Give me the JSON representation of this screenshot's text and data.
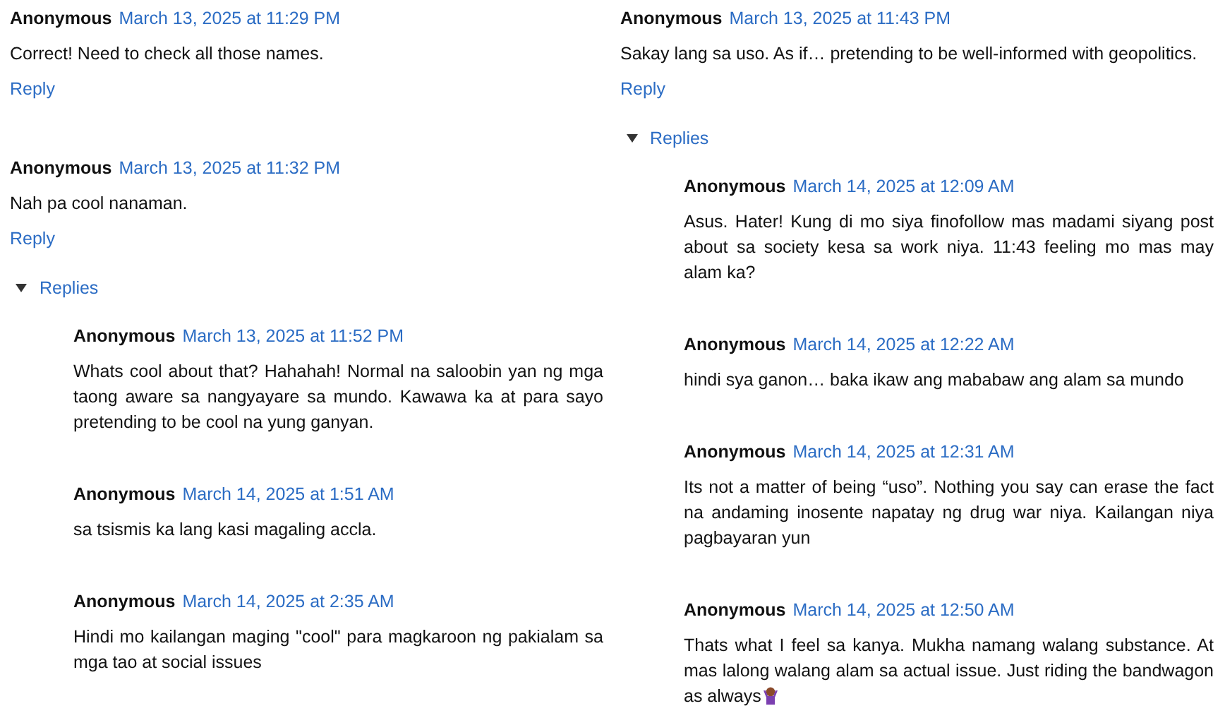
{
  "columns": [
    {
      "comments": [
        {
          "author": "Anonymous",
          "date": "March 13, 2025 at 11:29 PM",
          "body": "Correct! Need to check all those names.",
          "reply_link": "Reply"
        },
        {
          "author": "Anonymous",
          "date": "March 13, 2025 at 11:32 PM",
          "body": "Nah pa cool nanaman.",
          "reply_link": "Reply",
          "replies": {
            "label": "Replies",
            "expanded": true,
            "children": [
              {
                "author": "Anonymous",
                "date": "March 13, 2025 at 11:52 PM",
                "body": "Whats cool about that? Hahahah! Normal na saloobin yan ng mga taong aware sa nangyayare sa mundo. Kawawa ka at para sayo pretending to be cool na yung ganyan."
              },
              {
                "author": "Anonymous",
                "date": "March 14, 2025 at 1:51 AM",
                "body": "sa tsismis ka lang kasi magaling accla."
              },
              {
                "author": "Anonymous",
                "date": "March 14, 2025 at 2:35 AM",
                "body": "Hindi mo kailangan maging \"cool\" para magkaroon ng pakialam sa mga tao at social issues"
              }
            ]
          }
        }
      ]
    },
    {
      "comments": [
        {
          "author": "Anonymous",
          "date": "March 13, 2025 at 11:43 PM",
          "body": "Sakay lang sa uso. As if… pretending to be well-informed with geopolitics.",
          "reply_link": "Reply",
          "replies": {
            "label": "Replies",
            "expanded": true,
            "children": [
              {
                "author": "Anonymous",
                "date": "March 14, 2025 at 12:09 AM",
                "body": "Asus. Hater! Kung di mo siya finofollow mas madami siyang post about sa society kesa sa work niya. 11:43 feeling mo mas may alam ka?"
              },
              {
                "author": "Anonymous",
                "date": "March 14, 2025 at 12:22 AM",
                "body": "hindi sya ganon… baka ikaw ang mababaw ang alam sa mundo"
              },
              {
                "author": "Anonymous",
                "date": "March 14, 2025 at 12:31 AM",
                "body": "Its not a matter of being “uso”. Nothing you say can erase the fact na andaming inosente napatay ng drug war niya. Kailangan niya pagbayaran yun"
              },
              {
                "author": "Anonymous",
                "date": "March 14, 2025 at 12:50 AM",
                "body": "Thats what I feel sa kanya. Mukha namang walang substance. At mas lalong walang alam sa actual issue. Just riding the bandwagon as always",
                "kind": "emoji-ending"
              }
            ]
          }
        }
      ]
    }
  ]
}
